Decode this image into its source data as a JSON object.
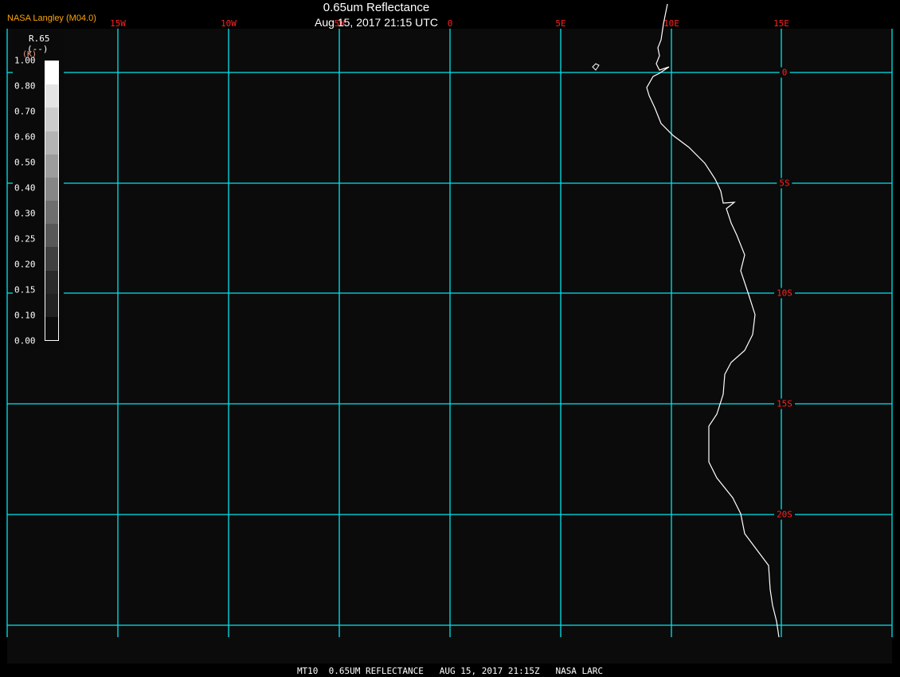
{
  "header": {
    "title": "0.65um Reflectance",
    "subtitle": "Aug 15, 2017 21:15 UTC",
    "brand": "NASA Langley (M04.0)"
  },
  "map": {
    "longitude_labels": [
      "15W",
      "10W",
      "5W",
      "0",
      "5E",
      "10E",
      "15E"
    ],
    "latitude_labels": [
      "0",
      "5S",
      "10S",
      "15S",
      "20S"
    ],
    "grid_color": "#00e5ee",
    "label_color": "#ff2020",
    "coastline_color": "#ffffff",
    "region": "West coast of Africa (Gabon to Namibia)"
  },
  "legend": {
    "title": "R.65",
    "unit": "(--)",
    "unit2": "(K)",
    "values": [
      "1.00",
      "0.80",
      "0.70",
      "0.60",
      "0.50",
      "0.40",
      "0.30",
      "0.25",
      "0.20",
      "0.15",
      "0.10",
      "0.00"
    ],
    "colors": [
      "#ffffff",
      "#e4e4e4",
      "#cccccc",
      "#b4b4b4",
      "#9c9c9c",
      "#868686",
      "#6e6e6e",
      "#585858",
      "#404040",
      "#2a2a2a",
      "#222222",
      "#0c0c0c"
    ]
  },
  "footer": {
    "text": "MT10  0.65UM REFLECTANCE   AUG 15, 2017 21:15Z   NASA LARC"
  }
}
